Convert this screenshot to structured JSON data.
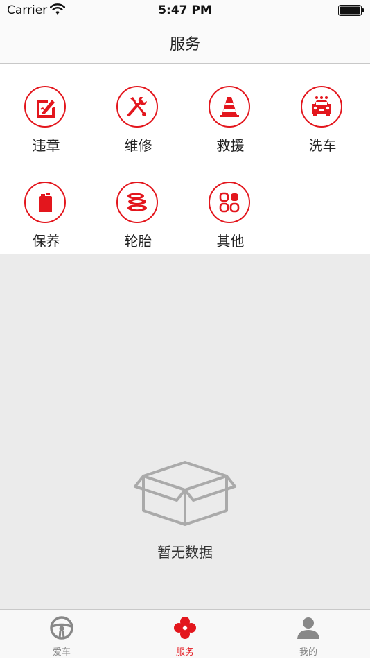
{
  "status_bar": {
    "carrier": "Carrier",
    "time": "5:47 PM"
  },
  "nav": {
    "title": "服务"
  },
  "services": [
    {
      "label": "违章",
      "icon": "violation-icon"
    },
    {
      "label": "维修",
      "icon": "repair-tools-icon"
    },
    {
      "label": "救援",
      "icon": "traffic-cone-icon"
    },
    {
      "label": "洗车",
      "icon": "car-wash-icon"
    },
    {
      "label": "保养",
      "icon": "oil-can-icon"
    },
    {
      "label": "轮胎",
      "icon": "tires-icon"
    },
    {
      "label": "其他",
      "icon": "grid-apps-icon"
    }
  ],
  "empty_state": {
    "text": "暂无数据",
    "icon": "empty-box-icon"
  },
  "tabs": [
    {
      "label": "爱车",
      "icon": "steering-wheel-icon",
      "active": false
    },
    {
      "label": "服务",
      "icon": "clover-icon",
      "active": true
    },
    {
      "label": "我的",
      "icon": "person-icon",
      "active": false
    }
  ],
  "colors": {
    "accent": "#e3161d",
    "inactive": "#888888",
    "background": "#ebebeb"
  }
}
